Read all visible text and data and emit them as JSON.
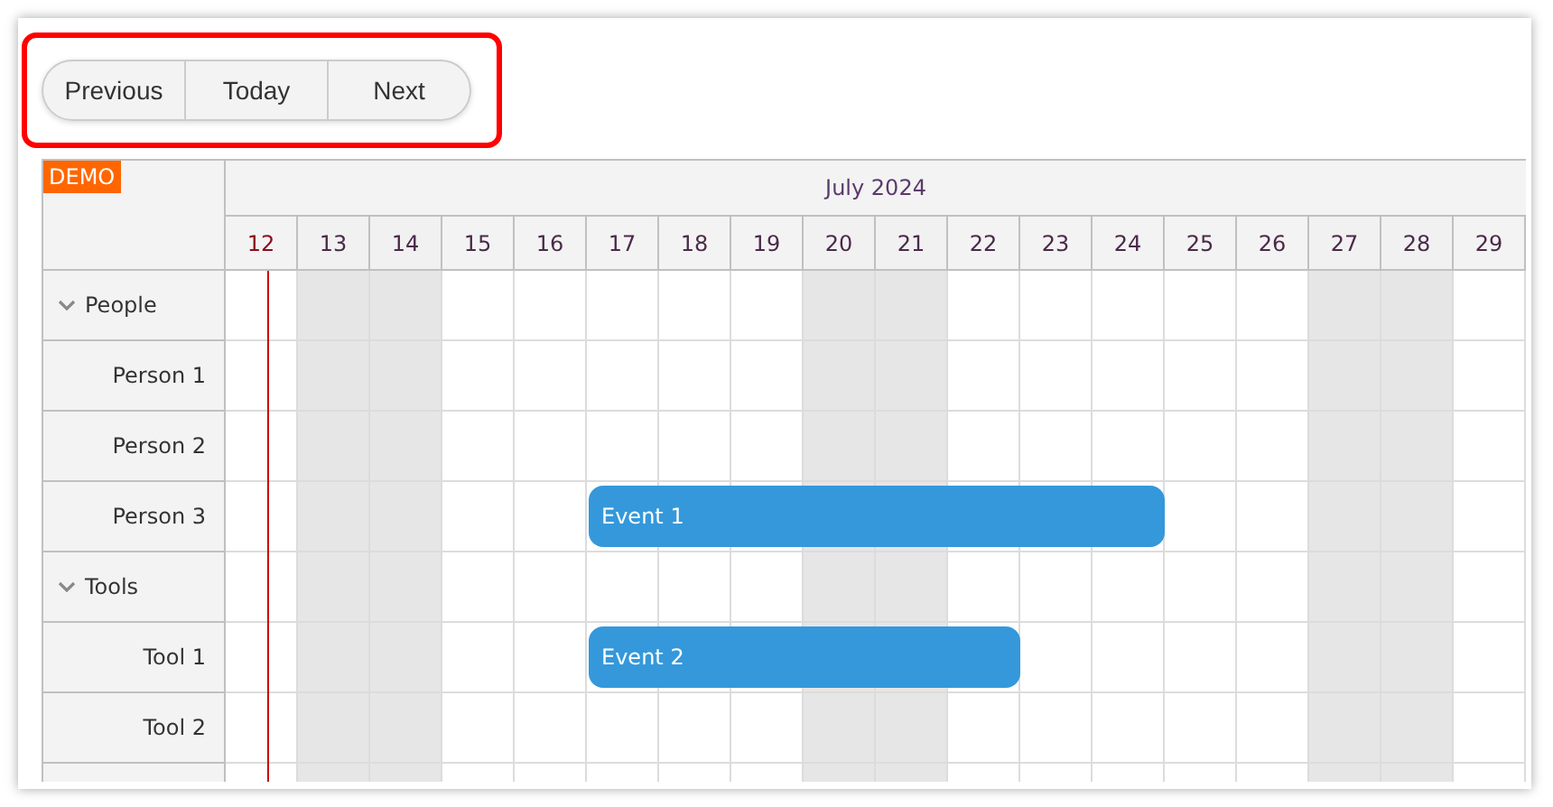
{
  "toolbar": {
    "buttons": [
      {
        "label": "Previous",
        "kind": "first"
      },
      {
        "label": "Today",
        "kind": "middle"
      },
      {
        "label": "Next",
        "kind": "last"
      }
    ]
  },
  "scheduler": {
    "corner_badge": "DEMO",
    "month": "July 2024",
    "days": [
      {
        "label": "12",
        "weekend": false,
        "today": true
      },
      {
        "label": "13",
        "weekend": true,
        "today": false
      },
      {
        "label": "14",
        "weekend": true,
        "today": false
      },
      {
        "label": "15",
        "weekend": false,
        "today": false
      },
      {
        "label": "16",
        "weekend": false,
        "today": false
      },
      {
        "label": "17",
        "weekend": false,
        "today": false
      },
      {
        "label": "18",
        "weekend": false,
        "today": false
      },
      {
        "label": "19",
        "weekend": false,
        "today": false
      },
      {
        "label": "20",
        "weekend": true,
        "today": false
      },
      {
        "label": "21",
        "weekend": true,
        "today": false
      },
      {
        "label": "22",
        "weekend": false,
        "today": false
      },
      {
        "label": "23",
        "weekend": false,
        "today": false
      },
      {
        "label": "24",
        "weekend": false,
        "today": false
      },
      {
        "label": "25",
        "weekend": false,
        "today": false
      },
      {
        "label": "26",
        "weekend": false,
        "today": false
      },
      {
        "label": "27",
        "weekend": true,
        "today": false
      },
      {
        "label": "28",
        "weekend": true,
        "today": false
      },
      {
        "label": "29",
        "weekend": false,
        "today": false
      }
    ],
    "resources": [
      {
        "name": "People",
        "expanded": true,
        "children": [
          {
            "name": "Person 1"
          },
          {
            "name": "Person 2"
          },
          {
            "name": "Person 3",
            "events": [
              {
                "text": "Event 1",
                "covers": [
                  false,
                  false,
                  false,
                  false,
                  false,
                  true,
                  true,
                  true,
                  true,
                  true,
                  true,
                  true,
                  true,
                  false,
                  false,
                  false,
                  false,
                  false
                ]
              }
            ]
          }
        ]
      },
      {
        "name": "Tools",
        "expanded": true,
        "children": [
          {
            "name": "Tool 1",
            "events": [
              {
                "text": "Event 2",
                "covers": [
                  false,
                  false,
                  false,
                  false,
                  false,
                  true,
                  true,
                  true,
                  true,
                  true,
                  true,
                  false,
                  false,
                  false,
                  false,
                  false,
                  false,
                  false
                ]
              }
            ]
          },
          {
            "name": "Tool 2"
          }
        ]
      }
    ]
  }
}
